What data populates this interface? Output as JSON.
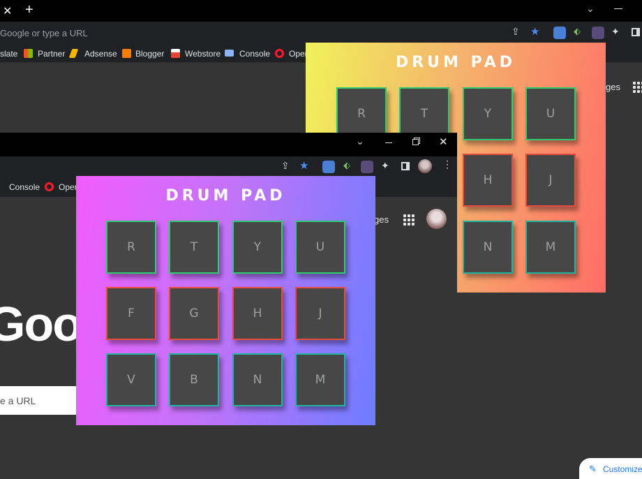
{
  "back_browser": {
    "omnibox_placeholder": "Google or type a URL",
    "bookmarks": [
      "slate",
      "Partner",
      "Adsense",
      "Blogger",
      "Webstore",
      "Console",
      "Opera"
    ],
    "ntp_text": "ges",
    "customize_label": "Customize"
  },
  "front_browser": {
    "bookmarks": [
      "Console",
      "Opera"
    ],
    "ntp_text": "ges",
    "google_logo": "Goog",
    "search_placeholder": "e a URL"
  },
  "drum_pad": {
    "title": "DRUM PAD",
    "keys": [
      "R",
      "T",
      "Y",
      "U",
      "F",
      "G",
      "H",
      "J",
      "V",
      "B",
      "N",
      "M"
    ]
  },
  "back_drum_visible_keys": [
    "R",
    "T",
    "Y",
    "U",
    "H",
    "J",
    "N",
    "M"
  ],
  "colors": {
    "pad_border_green": "#2ecc71",
    "pad_border_red": "#e74c3c",
    "front_gradient": [
      "#f25cff",
      "#6e7cff"
    ],
    "back_gradient": [
      "#f0f25a",
      "#ff6d66"
    ]
  }
}
